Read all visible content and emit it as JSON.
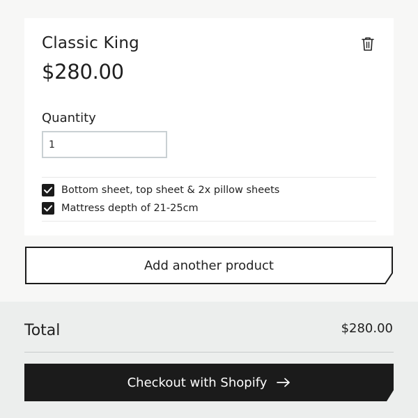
{
  "product": {
    "name": "Classic King",
    "price": "$280.00"
  },
  "quantity": {
    "label": "Quantity",
    "value": "1"
  },
  "options": [
    {
      "label": "Bottom sheet, top sheet & 2x pillow sheets",
      "checked": true
    },
    {
      "label": "Mattress depth of 21-25cm",
      "checked": true
    }
  ],
  "actions": {
    "add_another": "Add another product",
    "checkout": "Checkout with Shopify"
  },
  "summary": {
    "total_label": "Total",
    "total_value": "$280.00"
  },
  "icons": {
    "remove": "trash-icon",
    "check": "checkmark-icon",
    "checkout_arrow": "arrow-right-icon"
  },
  "colors": {
    "button_dark": "#1b1b1b",
    "summary_bg": "#eceeed",
    "page_bg": "#f7f7f6"
  }
}
